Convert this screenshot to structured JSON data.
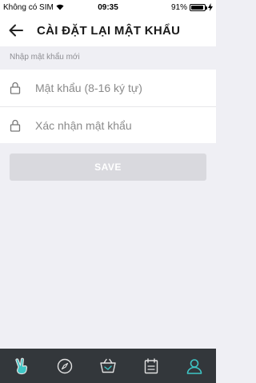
{
  "status_bar": {
    "carrier": "Không có SIM",
    "time": "09:35",
    "battery": "91%",
    "battery_level": 0.91
  },
  "header": {
    "back_icon": "arrow-left-icon",
    "title": "CÀI ĐẶT LẠI MẬT KHẨU"
  },
  "form": {
    "section_label": "Nhập mật khẩu mới",
    "password": {
      "value": "",
      "placeholder": "Mật khẩu (8-16 ký tự)",
      "icon": "lock-icon"
    },
    "confirm": {
      "value": "",
      "placeholder": "Xác nhận mật khẩu",
      "icon": "lock-icon"
    }
  },
  "save_label": "SAVE",
  "colors": {
    "tab_bar_bg": "#33373b",
    "tab_icon": "#e2e2e2",
    "tab_active": "#3ec6c6",
    "button_disabled": "#d9d9de"
  },
  "tabs": [
    {
      "icon": "hand-peace-icon",
      "active": false
    },
    {
      "icon": "compass-icon",
      "active": false
    },
    {
      "icon": "basket-icon",
      "active": false
    },
    {
      "icon": "calendar-icon",
      "active": false
    },
    {
      "icon": "user-icon",
      "active": true
    }
  ]
}
